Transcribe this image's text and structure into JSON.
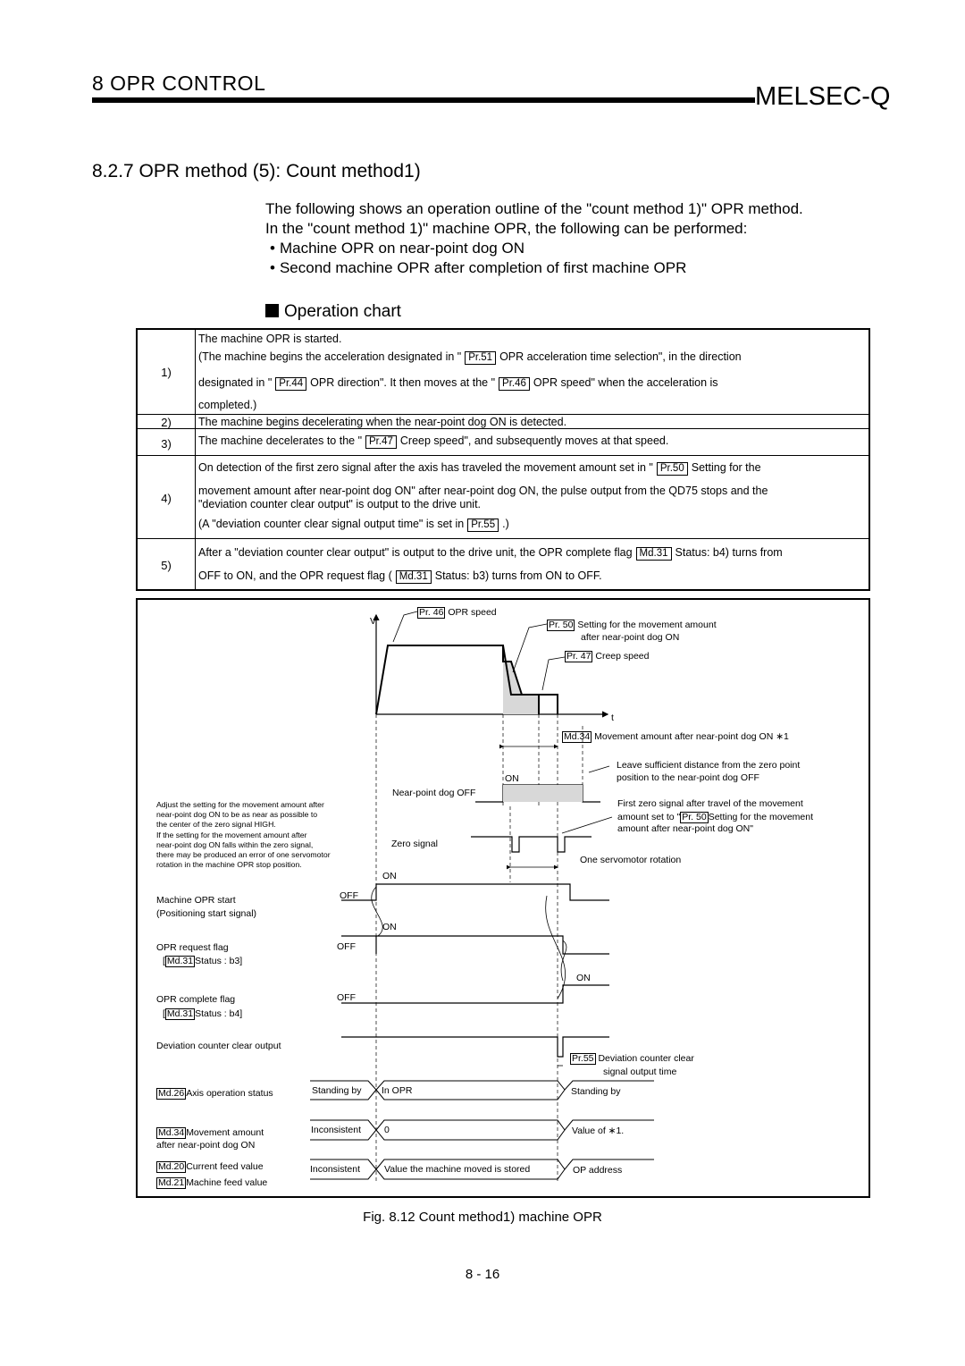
{
  "header": {
    "section": "8   OPR CONTROL",
    "brand": "MELSEC-Q"
  },
  "section_title": "8.2.7 OPR method (5): Count method1)",
  "intro": {
    "line1": "The following shows an operation outline of the \"count method 1)\" OPR method.",
    "line2": "In the \"count method 1)\" machine OPR, the following can be performed:",
    "bullets": [
      "Machine OPR on near-point dog ON",
      "Second machine OPR after completion of first machine OPR"
    ]
  },
  "chart_heading": "Operation chart",
  "steps": [
    {
      "num": "1)",
      "lines": [
        {
          "a": "The machine OPR is started."
        },
        {
          "a": "(The machine begins the acceleration designated in \"",
          "ref": "Pr.51",
          "b": "OPR acceleration time selection\", in the direction"
        },
        {
          "a": "designated in \"",
          "ref": "Pr.44",
          "b": "OPR direction\". It then moves at the \"",
          "ref2": "Pr.46",
          "c": "OPR speed\" when the acceleration is"
        },
        {
          "a": "completed.)"
        }
      ]
    },
    {
      "num": "2)",
      "lines": [
        {
          "a": "The machine begins decelerating when the near-point dog ON is detected."
        }
      ]
    },
    {
      "num": "3)",
      "lines": [
        {
          "a": "The machine decelerates to the \"",
          "ref": "Pr.47",
          "b": "Creep speed\", and subsequently moves at that speed."
        }
      ]
    },
    {
      "num": "4)",
      "lines": [
        {
          "a": "On detection of the first zero signal after the axis has traveled the movement amount set in \"",
          "ref": "Pr.50",
          "b": "Setting for the"
        },
        {
          "a": "movement amount after near-point dog ON\" after near-point dog ON, the pulse output from the QD75 stops and the"
        },
        {
          "a": "\"deviation counter clear output\" is output to the drive unit."
        },
        {
          "a": "(A \"deviation counter clear signal output time\" is set in",
          "ref": "Pr.55",
          "b": ".)"
        }
      ]
    },
    {
      "num": "5)",
      "lines": [
        {
          "a": "After a \"deviation counter clear output\" is output to the drive unit, the OPR complete flag",
          "ref": "Md.31",
          "b": "Status: b4) turns from"
        },
        {
          "a": "OFF to ON, and the OPR request flag (",
          "ref": "Md.31",
          "b": "Status: b3) turns from ON to OFF."
        }
      ]
    }
  ],
  "diagram": {
    "v_axis": "V",
    "t_axis": "t",
    "pr46": "Pr. 46",
    "pr46_label": "OPR speed",
    "pr50": "Pr. 50",
    "pr50_label1": "Setting for the movement amount",
    "pr50_label2": "after near-point dog ON",
    "pr47": "Pr. 47",
    "pr47_label": "Creep speed",
    "md34": "Md.34",
    "md34_label": "Movement amount after near-point dog ON ∗1",
    "leave_note1": "Leave sufficient distance from the zero point",
    "leave_note2": "position to the near-point dog OFF",
    "dog_on": "ON",
    "dog_label": "Near-point dog OFF",
    "first_zero1": "First zero signal after travel of the movement",
    "first_zero2a": "amount set to \"",
    "first_zero2ref": "Pr. 50",
    "first_zero2b": "Setting for the movement",
    "first_zero3": "amount after near-point dog ON\"",
    "zero_signal": "Zero signal",
    "one_rotation": "One servomotor rotation",
    "adjust_note": [
      "Adjust the setting for the movement amount after",
      "near-point dog ON to be as near as possible to",
      "the center of the zero signal HIGH.",
      "If the setting for the movement amount after",
      "near-point dog ON falls within the zero signal,",
      "there may be produced an error of one servomotor",
      "rotation in the machine OPR stop position."
    ],
    "signals": {
      "start_on": "ON",
      "start_off": "OFF",
      "start_label1": "Machine OPR start",
      "start_label2": "(Positioning start signal)",
      "req_on": "ON",
      "req_off": "OFF",
      "req_label": "OPR request flag",
      "req_ref": "Md.31",
      "req_status": "Status : b3]",
      "comp_on": "ON",
      "comp_off": "OFF",
      "comp_label": "OPR complete flag",
      "comp_ref": "Md.31",
      "comp_status": "Status : b4]",
      "dev_label": "Deviation counter clear output",
      "pr55": "Pr.55",
      "pr55_label1": "Deviation counter clear",
      "pr55_label2": "signal output time"
    },
    "md26": "Md.26",
    "md26_label": "Axis operation status",
    "md26_values": [
      "Standing by",
      "In OPR",
      "Standing by"
    ],
    "md34b": "Md.34",
    "md34b_label1": "Movement amount",
    "md34b_label2": "after near-point dog ON",
    "md34_values": [
      "Inconsistent",
      "0",
      "Value of  ∗1."
    ],
    "md20": "Md.20",
    "md20_label": "Current feed value",
    "md21": "Md.21",
    "md21_label": "Machine feed value",
    "md20_values": [
      "Inconsistent",
      "Value the machine moved is stored",
      "OP address"
    ]
  },
  "figure_caption": "Fig. 8.12 Count method1) machine OPR",
  "page_number": "8 - 16"
}
